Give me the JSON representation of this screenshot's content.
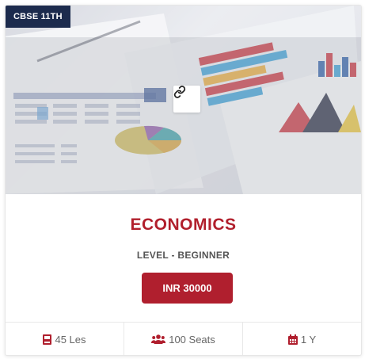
{
  "badge": {
    "label": "CBSE 11TH"
  },
  "course": {
    "title": "ECONOMICS",
    "level": "LEVEL - BEGINNER",
    "price": "INR 30000"
  },
  "stats": {
    "lessons": "45 Les",
    "seats": "100 Seats",
    "duration": "1 Y"
  },
  "icons": {
    "link": "link-icon",
    "lessons": "book-icon",
    "seats": "users-icon",
    "duration": "calendar-icon"
  },
  "colors": {
    "accent": "#b01f2e",
    "badge_bg": "#1c2b4d"
  }
}
